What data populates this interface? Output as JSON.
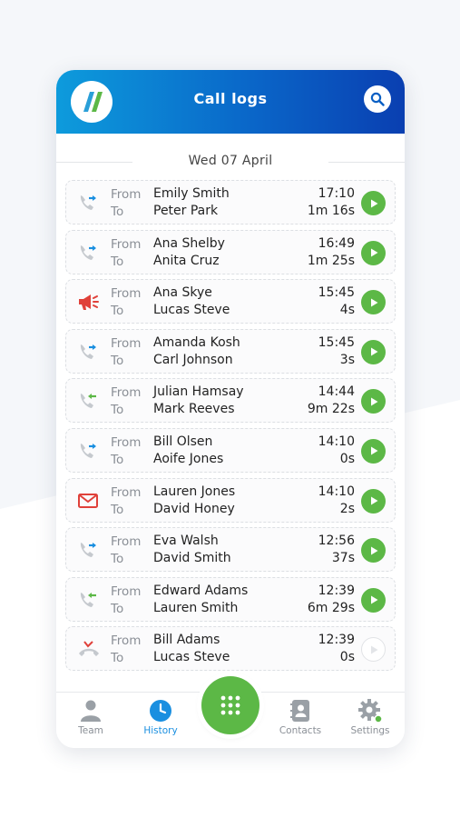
{
  "header": {
    "title": "Call logs",
    "logo_icon": "app-logo-icon",
    "search_icon": "search-icon"
  },
  "date_label": "Wed 07 April",
  "labels": {
    "from": "From",
    "to": "To"
  },
  "calls": [
    {
      "type": "outgoing",
      "from": "Emily Smith",
      "to": "Peter Park",
      "time": "17:10",
      "duration": "1m 16s",
      "playable": true
    },
    {
      "type": "outgoing",
      "from": "Ana Shelby",
      "to": "Anita Cruz",
      "time": "16:49",
      "duration": "1m 25s",
      "playable": true
    },
    {
      "type": "broadcast",
      "from": "Ana Skye",
      "to": "Lucas Steve",
      "time": "15:45",
      "duration": "4s",
      "playable": true
    },
    {
      "type": "outgoing",
      "from": "Amanda Kosh",
      "to": "Carl Johnson",
      "time": "15:45",
      "duration": "3s",
      "playable": true
    },
    {
      "type": "incoming",
      "from": "Julian Hamsay",
      "to": "Mark Reeves",
      "time": "14:44",
      "duration": "9m 22s",
      "playable": true
    },
    {
      "type": "outgoing",
      "from": "Bill Olsen",
      "to": "Aoife Jones",
      "time": "14:10",
      "duration": "0s",
      "playable": true
    },
    {
      "type": "voicemail",
      "from": "Lauren Jones",
      "to": "David Honey",
      "time": "14:10",
      "duration": "2s",
      "playable": true
    },
    {
      "type": "outgoing",
      "from": "Eva Walsh",
      "to": "David Smith",
      "time": "12:56",
      "duration": "37s",
      "playable": true
    },
    {
      "type": "incoming",
      "from": "Edward Adams",
      "to": "Lauren Smith",
      "time": "12:39",
      "duration": "6m 29s",
      "playable": true
    },
    {
      "type": "missed",
      "from": "Bill Adams",
      "to": "Lucas Steve",
      "time": "12:39",
      "duration": "0s",
      "playable": false
    }
  ],
  "nav": {
    "team": "Team",
    "history": "History",
    "contacts": "Contacts",
    "settings": "Settings",
    "active": "history"
  },
  "colors": {
    "accent_green": "#5cb846",
    "header_start": "#0d9bdc",
    "header_end": "#0a3fb1",
    "active_blue": "#1a8fe0"
  }
}
